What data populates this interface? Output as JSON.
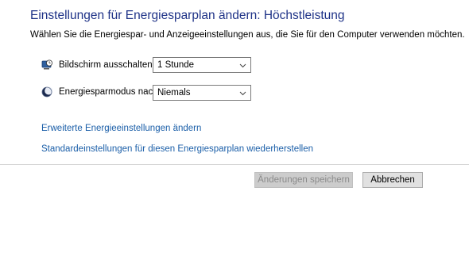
{
  "header": {
    "title": "Einstellungen für Energiesparplan ändern: Höchstleistung",
    "subtitle": "Wählen Sie die Energiespar- und Anzeigeeinstellungen aus, die Sie für den Computer verwenden möchten."
  },
  "settings": {
    "display_off": {
      "label": "Bildschirm ausschalten:",
      "value": "1 Stunde",
      "icon": "display-clock-icon"
    },
    "sleep_after": {
      "label": "Energiesparmodus nach:",
      "value": "Niemals",
      "icon": "moon-icon"
    }
  },
  "links": {
    "advanced": "Erweiterte Energieeinstellungen ändern",
    "restore_defaults": "Standardeinstellungen für diesen Energiesparplan wiederherstellen"
  },
  "buttons": {
    "save_label": "Änderungen speichern",
    "cancel_label": "Abbrechen"
  },
  "colors": {
    "title": "#1e3287",
    "link": "#1a5ea8"
  }
}
